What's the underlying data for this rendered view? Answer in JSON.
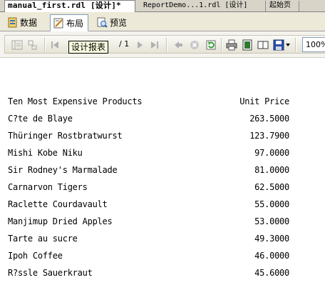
{
  "doc_tabs": [
    {
      "label": "manual_first.rdl [设计]*"
    },
    {
      "label": "ReportDemo...1.rdl [设计]"
    },
    {
      "label": "起始页"
    }
  ],
  "view_tabs": [
    {
      "label": "数据",
      "icon": "data-icon"
    },
    {
      "label": "布局",
      "icon": "layout-icon"
    },
    {
      "label": "预览",
      "icon": "preview-icon"
    }
  ],
  "toolbar": {
    "page_of": "/ 1",
    "tooltip": "设计报表",
    "zoom": "100%"
  },
  "report": {
    "header_name": "Ten Most Expensive Products",
    "header_price": "Unit Price",
    "rows": [
      {
        "name": "C?te de Blaye",
        "price": "263.5000"
      },
      {
        "name": "Thüringer Rostbratwurst",
        "price": "123.7900"
      },
      {
        "name": "Mishi Kobe Niku",
        "price": "97.0000"
      },
      {
        "name": "Sir Rodney's Marmalade",
        "price": "81.0000"
      },
      {
        "name": "Carnarvon Tigers",
        "price": "62.5000"
      },
      {
        "name": "Raclette Courdavault",
        "price": "55.0000"
      },
      {
        "name": "Manjimup Dried Apples",
        "price": "53.0000"
      },
      {
        "name": "Tarte au sucre",
        "price": "49.3000"
      },
      {
        "name": "Ipoh Coffee",
        "price": "46.0000"
      },
      {
        "name": "R?ssle Sauerkraut",
        "price": "45.6000"
      }
    ]
  }
}
